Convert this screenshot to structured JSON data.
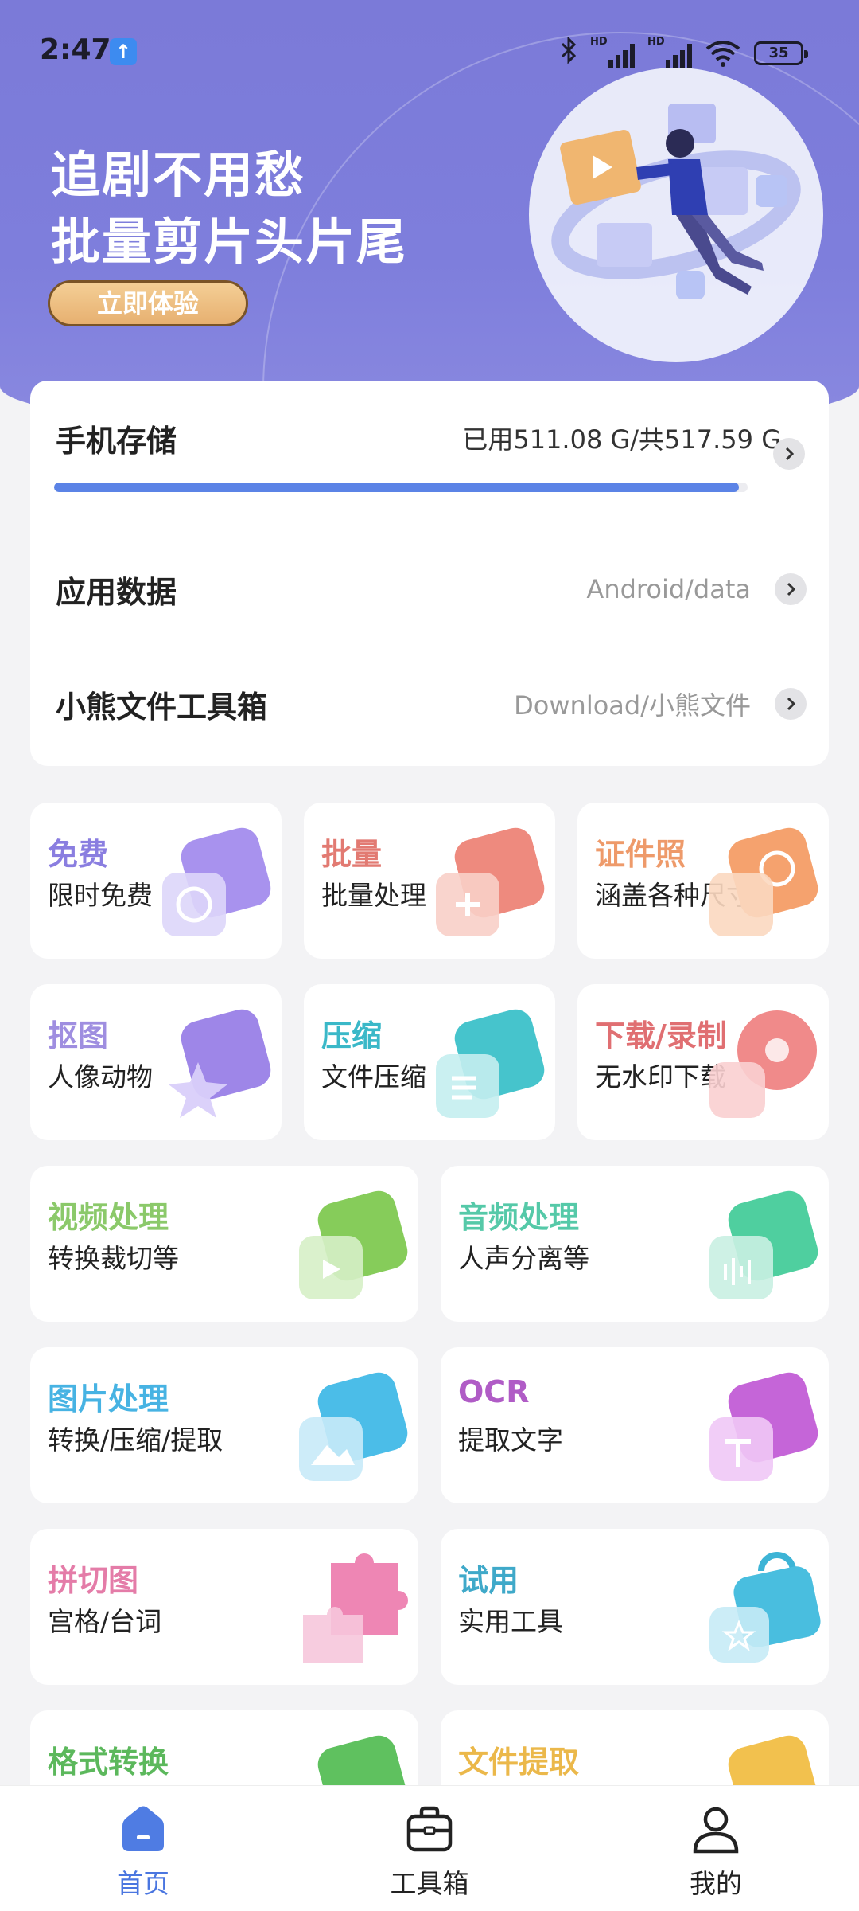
{
  "status_bar": {
    "time": "2:47",
    "network_1": "HD",
    "network_2": "HD",
    "battery": "35"
  },
  "banner": {
    "title_line1": "追剧不用愁",
    "title_line2": "批量剪片头片尾",
    "cta_label": "立即体验"
  },
  "storage": {
    "phone_storage_label": "手机存储",
    "phone_storage_value": "已用511.08 G/共517.59 G",
    "used_fraction": 0.987,
    "app_data_label": "应用数据",
    "app_data_path": "Android/data",
    "toolbox_label": "小熊文件工具箱",
    "toolbox_path": "Download/小熊文件"
  },
  "tools": [
    {
      "title": "免费",
      "subtitle": "限时免费",
      "color": "#8a7ee0"
    },
    {
      "title": "批量",
      "subtitle": "批量处理",
      "color": "#e27a72"
    },
    {
      "title": "证件照",
      "subtitle": "涵盖各种尺寸",
      "color": "#ee9a6a"
    },
    {
      "title": "抠图",
      "subtitle": "人像动物",
      "color": "#9f8ee0"
    },
    {
      "title": "压缩",
      "subtitle": "文件压缩",
      "color": "#3ab8c8"
    },
    {
      "title": "下载/录制",
      "subtitle": "无水印下载",
      "color": "#e06f72"
    },
    {
      "title": "视频处理",
      "subtitle": "转换裁切等",
      "color": "#8bc96a"
    },
    {
      "title": "音频处理",
      "subtitle": "人声分离等",
      "color": "#55c9a8"
    },
    {
      "title": "图片处理",
      "subtitle": "转换/压缩/提取",
      "color": "#47b3e3"
    },
    {
      "title": "OCR",
      "subtitle": "提取文字",
      "color": "#b05cc6"
    },
    {
      "title": "拼切图",
      "subtitle": "宫格/台词",
      "color": "#e47ca8"
    },
    {
      "title": "试用",
      "subtitle": "实用工具",
      "color": "#3fa9c9"
    },
    {
      "title": "格式转换",
      "subtitle": "",
      "color": "#5cb85c"
    },
    {
      "title": "文件提取",
      "subtitle": "",
      "color": "#ebb84a"
    }
  ],
  "tabs": [
    {
      "label": "首页"
    },
    {
      "label": "工具箱"
    },
    {
      "label": "我的"
    }
  ],
  "colors": {
    "banner": "#7b7ad8",
    "accent_blue": "#4a76e0",
    "cta": "#e7b070"
  }
}
